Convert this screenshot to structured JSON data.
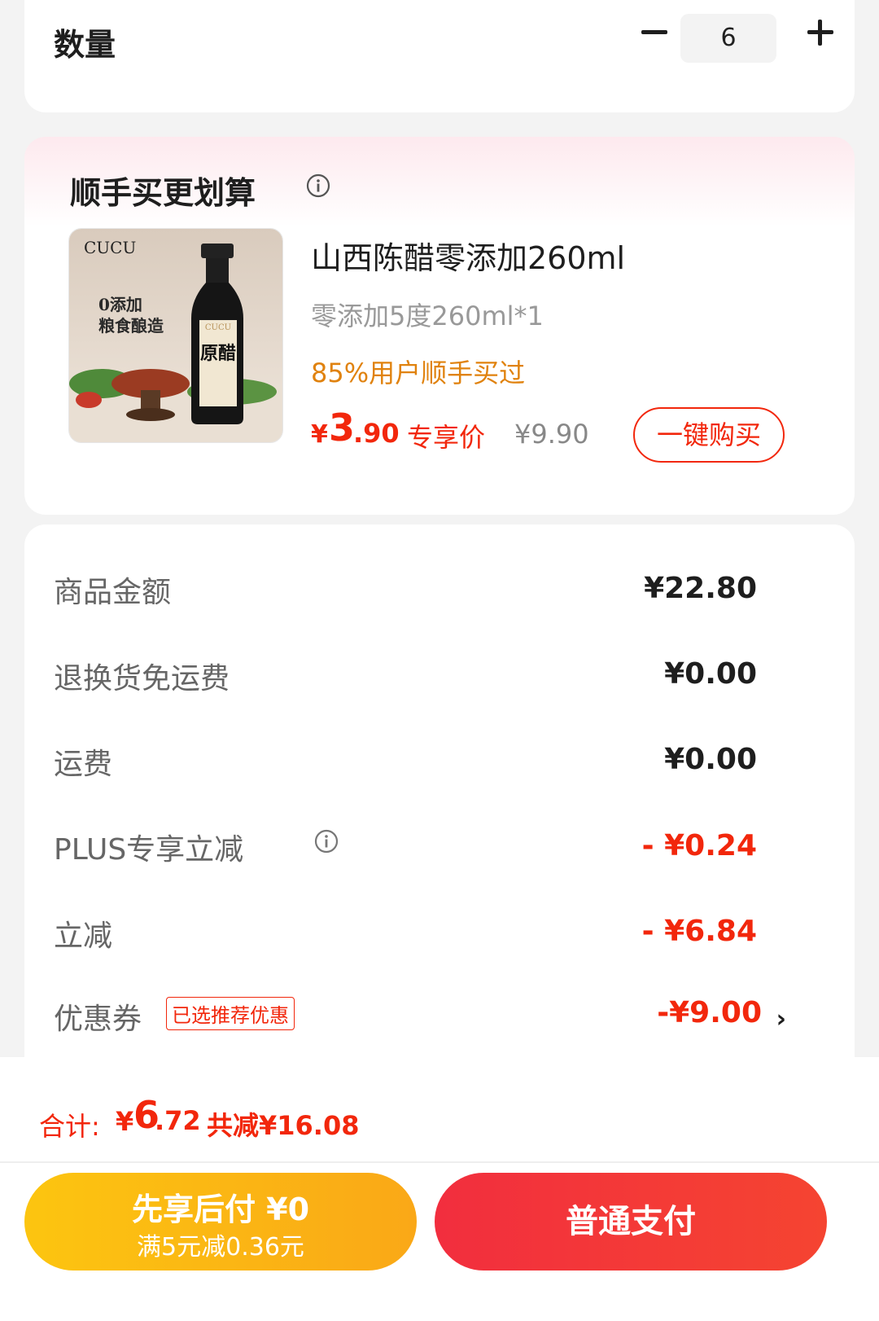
{
  "quantity": {
    "label": "数量",
    "value": "6"
  },
  "addon": {
    "title": "顺手买更划算",
    "product": {
      "image_brand": "CUCU",
      "image_text_1": "0添加",
      "image_text_2": "粮食酿造",
      "image_label": "原醋",
      "name": "山西陈醋零添加260ml",
      "spec": "零添加5度260ml*1",
      "social_proof": "85%用户顺手买过",
      "price_symbol": "¥",
      "price_int": "3",
      "price_dec": ".90",
      "price_tag": "专享价",
      "original_price": "¥9.90",
      "buy_button": "一键购买"
    }
  },
  "summary": {
    "rows": [
      {
        "label": "商品金额",
        "value": "¥22.80"
      },
      {
        "label": "退换货免运费",
        "value": "¥0.00"
      },
      {
        "label": "运费",
        "value": "¥0.00"
      },
      {
        "label": "PLUS专享立减",
        "value": "- ¥0.24"
      },
      {
        "label": "立减",
        "value": "- ¥6.84"
      },
      {
        "label": "优惠券",
        "value": "-¥9.00",
        "badge": "已选推荐优惠"
      }
    ]
  },
  "footer": {
    "total_label": "合计:",
    "total_symbol": "¥",
    "total_int": "6",
    "total_dec": ".72",
    "total_saved": "共减¥16.08",
    "bnpl_main": "先享后付 ¥0",
    "bnpl_sub": "满5元减0.36元",
    "pay_label": "普通支付"
  },
  "colors": {
    "accent_red": "#f2270c",
    "orange_text": "#e0820e",
    "bnpl_yellow": "#fcc510",
    "pay_red": "#f22e3e"
  }
}
